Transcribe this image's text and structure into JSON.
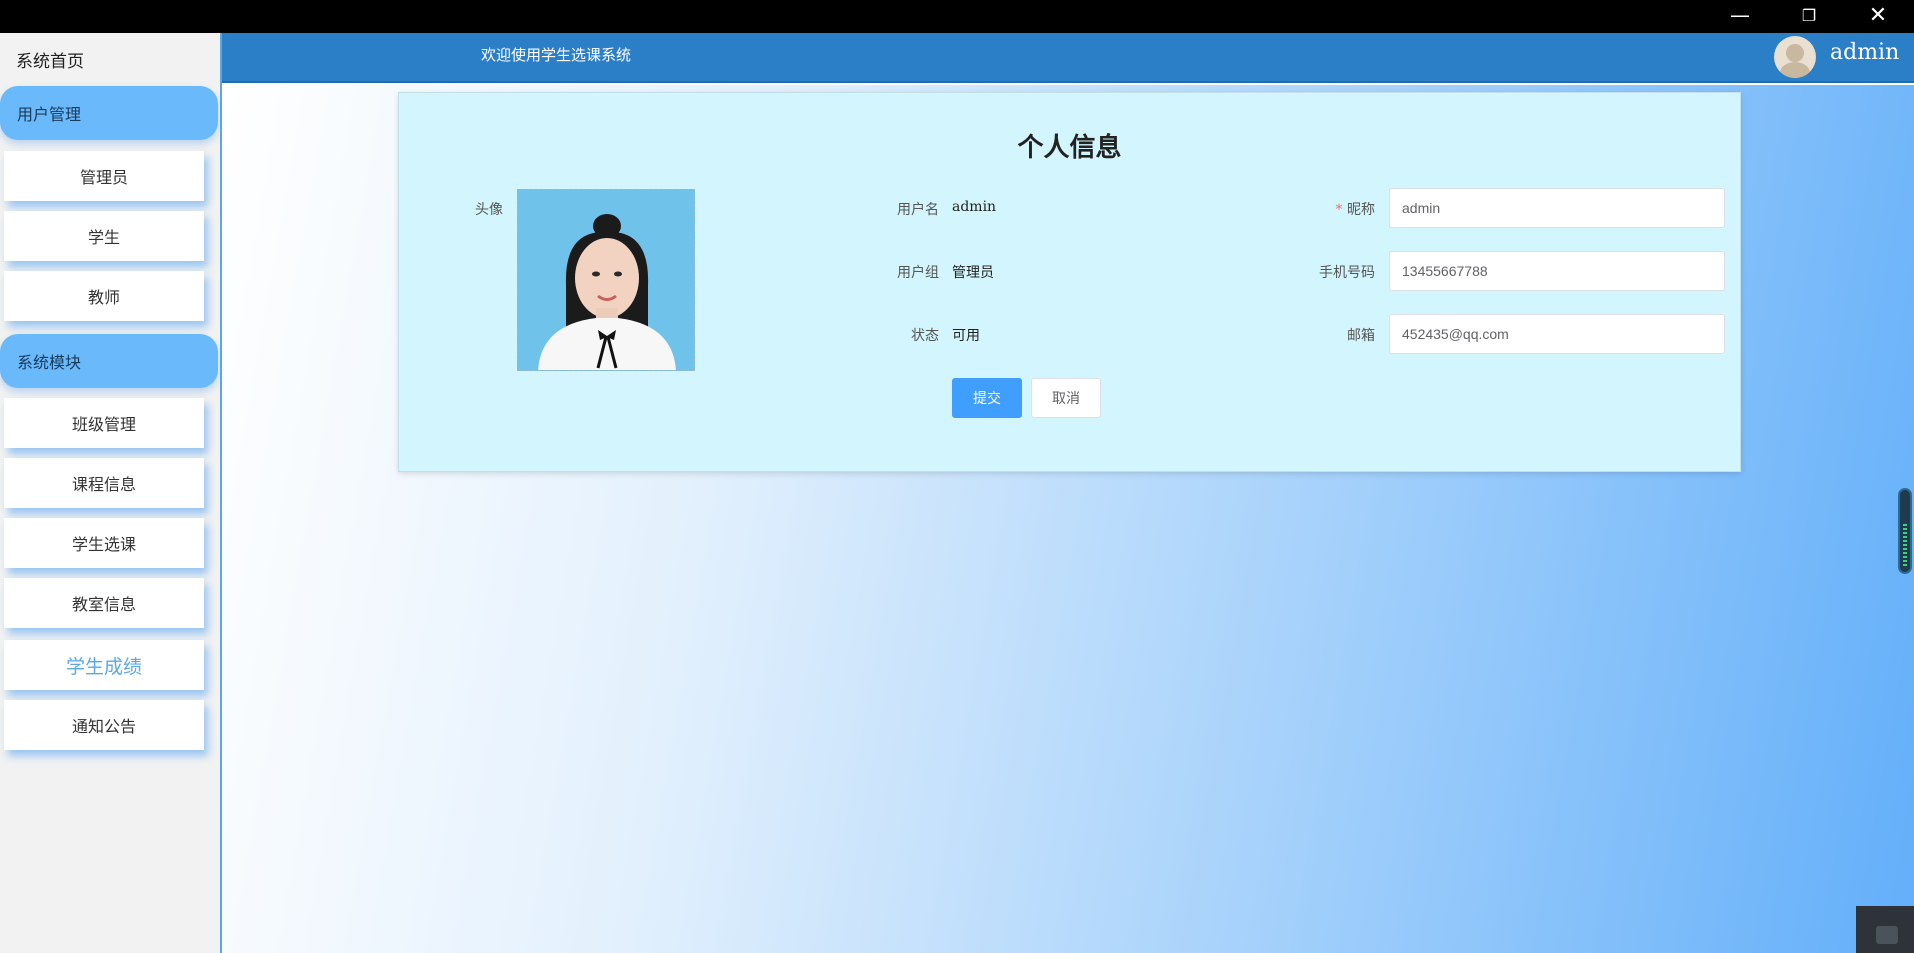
{
  "header": {
    "title": "欢迎使用学生选课系统",
    "user": "admin"
  },
  "sidebar": {
    "home": "系统首页",
    "groups": [
      {
        "label": "用户管理",
        "items": [
          "管理员",
          "学生",
          "教师"
        ]
      },
      {
        "label": "系统模块",
        "items": [
          "班级管理",
          "课程信息",
          "学生选课",
          "教室信息",
          "学生成绩",
          "通知公告"
        ]
      }
    ],
    "active_item": "学生成绩"
  },
  "profile": {
    "title": "个人信息",
    "avatar_label": "头像",
    "username_label": "用户名",
    "username": "admin",
    "group_label": "用户组",
    "group": "管理员",
    "status_label": "状态",
    "status": "可用",
    "nickname_label": "昵称",
    "nickname": "admin",
    "phone_label": "手机号码",
    "phone": "13455667788",
    "email_label": "邮箱",
    "email": "452435@qq.com",
    "required_mark": "*",
    "submit_label": "提交",
    "cancel_label": "取消"
  },
  "colors": {
    "header_bg": "#2b7fc6",
    "group_bg": "#69b9fb",
    "primary": "#409eff",
    "card_bg": "#d3f5fd"
  },
  "icons": {
    "minimize": "minimize-icon",
    "maximize": "restore-icon",
    "close": "close-icon"
  }
}
